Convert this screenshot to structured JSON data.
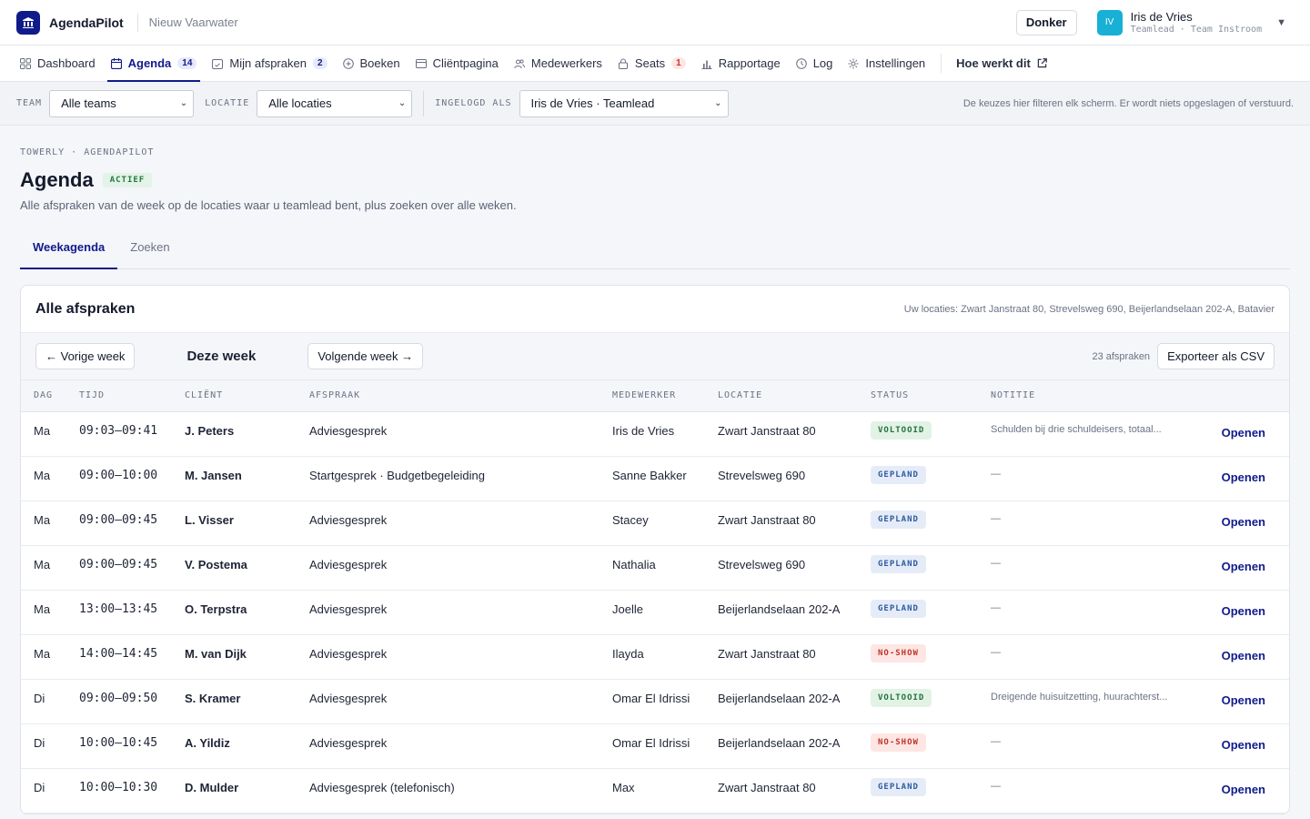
{
  "app": {
    "name": "AgendaPilot",
    "org": "Nieuw Vaarwater",
    "theme_button": "Donker"
  },
  "user": {
    "initials": "IV",
    "name": "Iris de Vries",
    "role": "Teamlead · Team Instroom"
  },
  "nav": [
    {
      "label": "Dashboard",
      "icon": "grid-icon"
    },
    {
      "label": "Agenda",
      "icon": "calendar-icon",
      "badge": "14",
      "active": true
    },
    {
      "label": "Mijn afspraken",
      "icon": "calendar-check-icon",
      "badge": "2"
    },
    {
      "label": "Boeken",
      "icon": "plus-circle-icon"
    },
    {
      "label": "Cliëntpagina",
      "icon": "window-icon"
    },
    {
      "label": "Medewerkers",
      "icon": "users-icon"
    },
    {
      "label": "Seats",
      "icon": "lock-icon",
      "badge": "1",
      "badge_warn": true
    },
    {
      "label": "Rapportage",
      "icon": "bar-chart-icon"
    },
    {
      "label": "Log",
      "icon": "clock-icon"
    },
    {
      "label": "Instellingen",
      "icon": "gear-icon"
    }
  ],
  "nav_help": "Hoe werkt dit",
  "filters": {
    "team_label": "TEAM",
    "team_value": "Alle teams",
    "location_label": "LOCATIE",
    "location_value": "Alle locaties",
    "login_label": "INGELOGD ALS",
    "login_value": "Iris de Vries · Teamlead",
    "hint": "De keuzes hier filteren elk scherm. Er wordt niets opgeslagen of verstuurd."
  },
  "page": {
    "breadcrumb": "TOWERLY · AGENDAPILOT",
    "title": "Agenda",
    "status": "ACTIEF",
    "subtitle": "Alle afspraken van de week op de locaties waar u teamlead bent, plus zoeken over alle weken.",
    "tabs": [
      "Weekagenda",
      "Zoeken"
    ]
  },
  "card": {
    "title": "Alle afspraken",
    "locations_note": "Uw locaties: Zwart Janstraat 80, Strevelsweg 690, Beijerlandselaan 202-A, Batavier",
    "prev": "← Vorige week",
    "current": "Deze week",
    "next": "Volgende week →",
    "count": "23 afspraken",
    "export": "Exporteer als CSV"
  },
  "table": {
    "headers": [
      "DAG",
      "TIJD",
      "CLIËNT",
      "AFSPRAAK",
      "MEDEWERKER",
      "LOCATIE",
      "STATUS",
      "NOTITIE"
    ],
    "open_label": "Openen",
    "rows": [
      {
        "day": "Ma",
        "time": "09:03–09:41",
        "client": "J. Peters",
        "appt": "Adviesgesprek",
        "emp": "Iris de Vries",
        "loc": "Zwart Janstraat 80",
        "status": "VOLTOOID",
        "kind": "done",
        "note": "Schulden bij drie schuldeisers, totaal..."
      },
      {
        "day": "Ma",
        "time": "09:00–10:00",
        "client": "M. Jansen",
        "appt": "Startgesprek · Budgetbegeleiding",
        "emp": "Sanne Bakker",
        "loc": "Strevelsweg 690",
        "status": "GEPLAND",
        "kind": "plan",
        "note": "—"
      },
      {
        "day": "Ma",
        "time": "09:00–09:45",
        "client": "L. Visser",
        "appt": "Adviesgesprek",
        "emp": "Stacey",
        "loc": "Zwart Janstraat 80",
        "status": "GEPLAND",
        "kind": "plan",
        "note": "—"
      },
      {
        "day": "Ma",
        "time": "09:00–09:45",
        "client": "V. Postema",
        "appt": "Adviesgesprek",
        "emp": "Nathalia",
        "loc": "Strevelsweg 690",
        "status": "GEPLAND",
        "kind": "plan",
        "note": "—"
      },
      {
        "day": "Ma",
        "time": "13:00–13:45",
        "client": "O. Terpstra",
        "appt": "Adviesgesprek",
        "emp": "Joelle",
        "loc": "Beijerlandselaan 202-A",
        "status": "GEPLAND",
        "kind": "plan",
        "note": "—"
      },
      {
        "day": "Ma",
        "time": "14:00–14:45",
        "client": "M. van Dijk",
        "appt": "Adviesgesprek",
        "emp": "Ilayda",
        "loc": "Zwart Janstraat 80",
        "status": "NO-SHOW",
        "kind": "noshow",
        "note": "—"
      },
      {
        "day": "Di",
        "time": "09:00–09:50",
        "client": "S. Kramer",
        "appt": "Adviesgesprek",
        "emp": "Omar El Idrissi",
        "loc": "Beijerlandselaan 202-A",
        "status": "VOLTOOID",
        "kind": "done",
        "note": "Dreigende huisuitzetting, huurachterst..."
      },
      {
        "day": "Di",
        "time": "10:00–10:45",
        "client": "A. Yildiz",
        "appt": "Adviesgesprek",
        "emp": "Omar El Idrissi",
        "loc": "Beijerlandselaan 202-A",
        "status": "NO-SHOW",
        "kind": "noshow",
        "note": "—"
      },
      {
        "day": "Di",
        "time": "10:00–10:30",
        "client": "D. Mulder",
        "appt": "Adviesgesprek (telefonisch)",
        "emp": "Max",
        "loc": "Zwart Janstraat 80",
        "status": "GEPLAND",
        "kind": "plan",
        "note": "—"
      }
    ]
  },
  "colors": {
    "accent": "#101b8a",
    "avatar": "#18b0d4"
  }
}
